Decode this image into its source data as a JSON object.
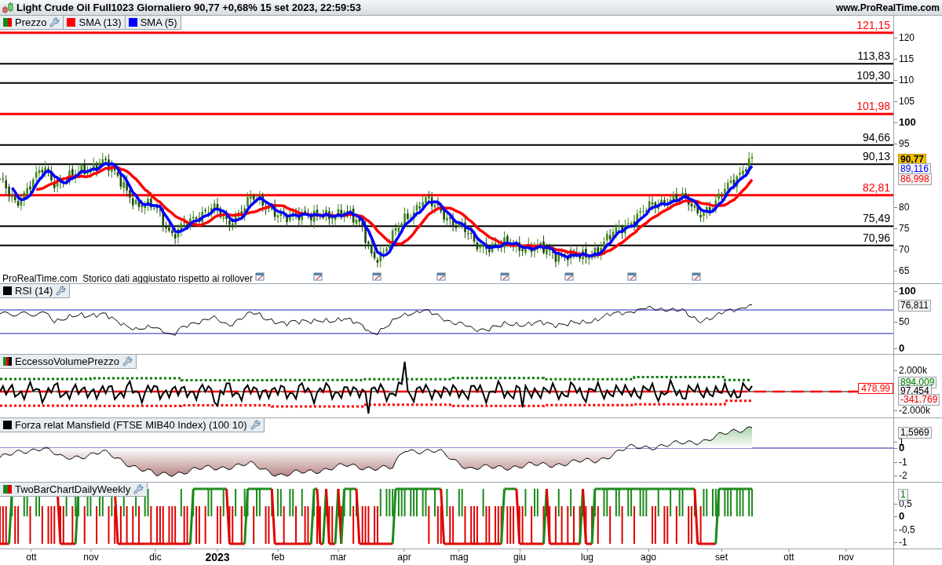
{
  "title_bar": {
    "title": "Light Crude Oil Full1023 Giornaliero 90,77 +0,68% 15 set 2023, 22:59:53",
    "website": "www.ProRealTime.com"
  },
  "price_panel": {
    "legend": [
      {
        "label": "Prezzo",
        "swatch": [
          {
            "color": "#1a8a1a"
          },
          {
            "color": "#e00000"
          }
        ],
        "settings": true
      },
      {
        "label": "SMA (13)",
        "swatch": [
          {
            "color": "#ff0000"
          }
        ],
        "settings": false
      },
      {
        "label": "SMA (5)",
        "swatch": [
          {
            "color": "#0000ff"
          }
        ],
        "settings": false
      }
    ],
    "levels": [
      {
        "label": "121,15",
        "color": "#ff0000"
      },
      {
        "label": "113,83",
        "color": "#000000"
      },
      {
        "label": "109,30",
        "color": "#000000"
      },
      {
        "label": "101,98",
        "color": "#ff0000"
      },
      {
        "label": "94,66",
        "color": "#000000"
      },
      {
        "label": "90,13",
        "color": "#000000"
      },
      {
        "label": "82,81",
        "color": "#ff0000"
      },
      {
        "label": "75,49",
        "color": "#000000"
      },
      {
        "label": "70,96",
        "color": "#000000"
      }
    ],
    "axis_ticks": [
      {
        "label": "120",
        "bold": false
      },
      {
        "label": "115",
        "bold": false
      },
      {
        "label": "110",
        "bold": false
      },
      {
        "label": "105",
        "bold": false
      },
      {
        "label": "100",
        "bold": true
      },
      {
        "label": "95",
        "bold": false
      },
      {
        "label": "80",
        "bold": false
      },
      {
        "label": "75",
        "bold": false
      },
      {
        "label": "70",
        "bold": false
      },
      {
        "label": "65",
        "bold": false
      }
    ],
    "value_tags": [
      {
        "label": "90,77",
        "kind": "last"
      },
      {
        "label": "89,116",
        "kind": "plain",
        "color": "#0000ff"
      },
      {
        "label": "86,998",
        "kind": "plain",
        "color": "#ff0000"
      }
    ],
    "note": "ProRealTime.com  Storico dati aggiustato rispetto ai rollover"
  },
  "indicator_panels": [
    {
      "kind": "rsi",
      "label": "RSI (14)",
      "swatch": [
        {
          "color": "#000000"
        }
      ],
      "settings": true,
      "axis_ticks": [
        {
          "label": "100",
          "bold": true
        },
        {
          "label": "50",
          "bold": false
        },
        {
          "label": "0",
          "bold": true
        }
      ],
      "value_tags": [
        {
          "label": "76,811",
          "kind": "plain",
          "color": "#000000"
        }
      ]
    },
    {
      "kind": "volume_excess",
      "label": "EccessoVolumePrezzo",
      "swatch": [
        {
          "color": "#1a8a1a"
        },
        {
          "color": "#e00000"
        },
        {
          "color": "#000000"
        }
      ],
      "settings": true,
      "axis_ticks": [
        {
          "label": "2.000k",
          "bold": false
        },
        {
          "label": "-2.000k",
          "bold": false
        }
      ],
      "value_tags": [
        {
          "label": "894.009",
          "kind": "plain",
          "color": "#008000"
        },
        {
          "label": "97.454",
          "kind": "plain",
          "color": "#000000"
        },
        {
          "label": "-341.769",
          "kind": "plain",
          "color": "#ff0000"
        }
      ],
      "level_tag": {
        "label": "478,99",
        "color": "#ff0000"
      }
    },
    {
      "kind": "relative_strength",
      "label": "Forza relat Mansfield (FTSE MIB40 Index) (100 10)",
      "swatch": [
        {
          "color": "#000000"
        }
      ],
      "settings": true,
      "axis_ticks": [
        {
          "label": "1",
          "bold": false
        },
        {
          "label": "0",
          "bold": true
        },
        {
          "label": "-1",
          "bold": false
        },
        {
          "label": "-2",
          "bold": false
        }
      ],
      "value_tags": [
        {
          "label": "1,5969",
          "kind": "plain",
          "color": "#000000"
        }
      ]
    },
    {
      "kind": "two_bar",
      "label": "TwoBarChartDailyWeekly",
      "swatch": [
        {
          "color": "#1a8a1a"
        },
        {
          "color": "#e00000"
        }
      ],
      "settings": true,
      "axis_ticks": [
        {
          "label": "0,5",
          "bold": false
        },
        {
          "label": "0",
          "bold": true
        },
        {
          "label": "-0,5",
          "bold": false
        },
        {
          "label": "-1",
          "bold": false
        }
      ],
      "value_tags": [
        {
          "label": "1",
          "kind": "plain",
          "color": "#008000"
        }
      ]
    }
  ],
  "x_axis": [
    {
      "label": "ott",
      "bold": false
    },
    {
      "label": "nov",
      "bold": false
    },
    {
      "label": "dic",
      "bold": false
    },
    {
      "label": "2023",
      "bold": true
    },
    {
      "label": "feb",
      "bold": false
    },
    {
      "label": "mar",
      "bold": false
    },
    {
      "label": "apr",
      "bold": false
    },
    {
      "label": "mag",
      "bold": false
    },
    {
      "label": "giu",
      "bold": false
    },
    {
      "label": "lug",
      "bold": false
    },
    {
      "label": "ago",
      "bold": false
    },
    {
      "label": "set",
      "bold": false
    },
    {
      "label": "ott",
      "bold": false
    },
    {
      "label": "nov",
      "bold": false
    }
  ]
}
